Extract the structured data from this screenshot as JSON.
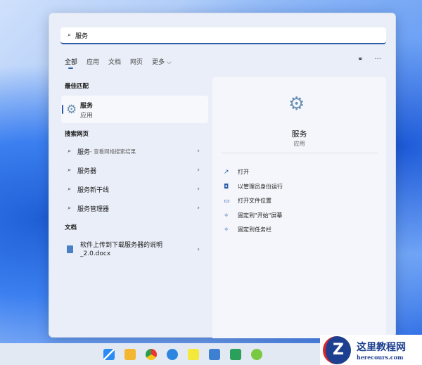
{
  "search": {
    "value": "服务"
  },
  "tabs": [
    "全部",
    "应用",
    "文档",
    "网页",
    "更多 ⌵"
  ],
  "sections": {
    "best": "最佳匹配",
    "web": "搜索网页",
    "docs": "文档"
  },
  "best_match": {
    "title": "服务",
    "type": "应用"
  },
  "web_results": [
    {
      "label": "服务",
      "sub": " - 查看网络搜索结果"
    },
    {
      "label": "服务器",
      "sub": ""
    },
    {
      "label": "服务新干线",
      "sub": ""
    },
    {
      "label": "服务管理器",
      "sub": ""
    }
  ],
  "document": {
    "line1": "软件上传到下载服务器的说明",
    "line2": "_2.0.docx"
  },
  "detail": {
    "name": "服务",
    "type": "应用",
    "actions": [
      {
        "label": "打开",
        "icon": "open-external-icon"
      },
      {
        "label": "以管理员身份运行",
        "icon": "shield-icon"
      },
      {
        "label": "打开文件位置",
        "icon": "folder-icon"
      },
      {
        "label": "固定到\"开始\"屏幕",
        "icon": "pin-icon"
      },
      {
        "label": "固定到任务栏",
        "icon": "pin-icon"
      }
    ]
  },
  "watermark": {
    "title": "这里教程网",
    "url": "herecours.com"
  }
}
